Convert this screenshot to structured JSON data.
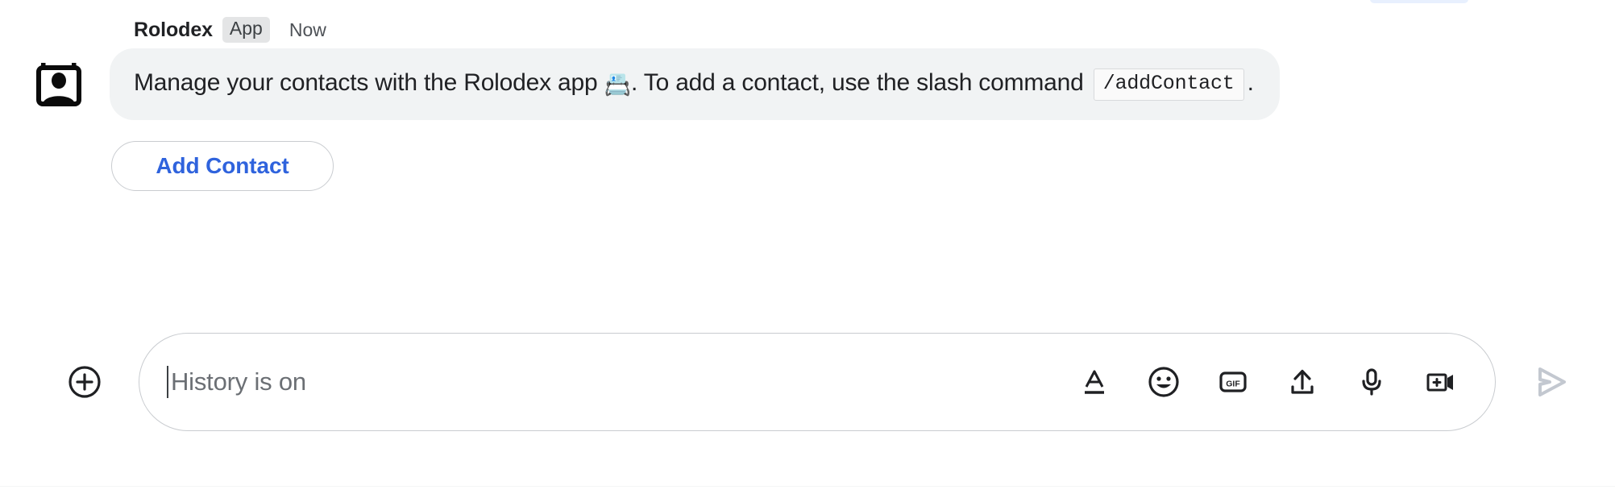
{
  "message": {
    "sender": "Rolodex",
    "badge": "App",
    "timestamp": "Now",
    "avatar_icon": "contact-card-icon",
    "text_part_1": "Manage your contacts with the Rolodex app ",
    "emoji": "📇",
    "text_part_2": ". To add a contact, use the slash command ",
    "code_chip": "/addContact",
    "text_part_3": ".",
    "action_button": "Add Contact",
    "accent_color": "#2f63dd",
    "bubble_color": "#f1f3f4"
  },
  "composer": {
    "add_button_icon": "plus-circle-icon",
    "placeholder": "History is on",
    "value": "",
    "tools": [
      {
        "icon": "format-text-icon",
        "label": "Format"
      },
      {
        "icon": "emoji-icon",
        "label": "Emoji"
      },
      {
        "icon": "gif-icon",
        "label": "GIF"
      },
      {
        "icon": "upload-icon",
        "label": "Upload file"
      },
      {
        "icon": "microphone-icon",
        "label": "Voice message"
      },
      {
        "icon": "add-video-icon",
        "label": "Video message"
      }
    ],
    "gif_label": "GIF",
    "send_icon": "send-icon",
    "send_enabled": false,
    "send_color": "#c3c8d0"
  }
}
